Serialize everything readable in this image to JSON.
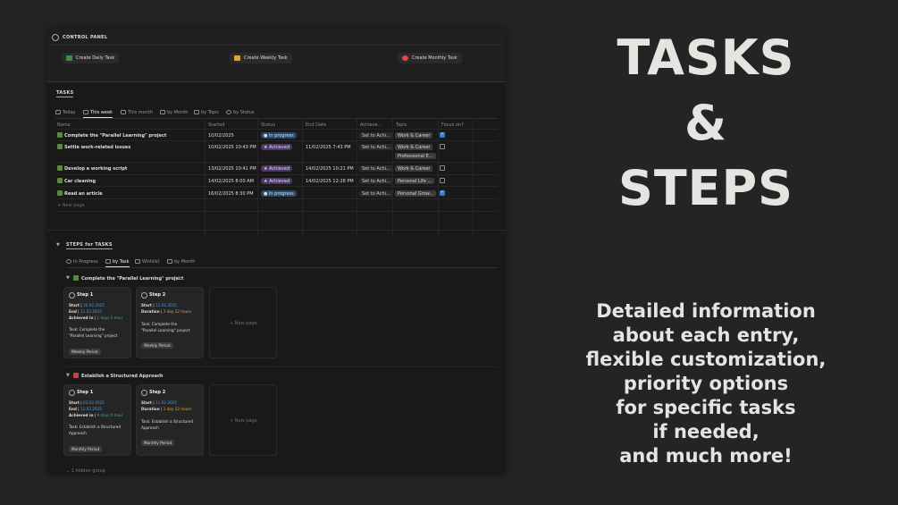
{
  "control_panel": {
    "title": "CONTROL PANEL",
    "buttons": [
      {
        "label": "Create Daily Task",
        "color": "#3f8f4a"
      },
      {
        "label": "Create Weekly Task",
        "color": "#e0a23a"
      },
      {
        "label": "Create Monthly Task",
        "color": "#e04b4b"
      }
    ]
  },
  "tasks": {
    "section_label": "TASKS",
    "tabs": [
      "Today",
      "This week",
      "This month",
      "by Month",
      "by Topic",
      "by Status"
    ],
    "active_tab": "This week",
    "columns": [
      "Name",
      "Started",
      "Status",
      "End Date",
      "Achieve...",
      "Topic",
      "Focus on?"
    ],
    "rows": [
      {
        "name": "Complete the \"Parallel Learning\" project",
        "started": "10/02/2025",
        "status": "In progress",
        "end": "",
        "achieve": "Set to Achi...",
        "topics": [
          "Work & Career"
        ],
        "focus": true
      },
      {
        "name": "Settle work-related issues",
        "started": "10/02/2025 10:43 PM",
        "status": "Achieved",
        "end": "11/02/2025 7:43 PM",
        "achieve": "Set to Achi...",
        "topics": [
          "Work & Career",
          "Professional E..."
        ],
        "focus": false
      },
      {
        "name": "Develop a working script",
        "started": "13/02/2025 10:41 PM",
        "status": "Achieved",
        "end": "14/02/2025 10:21 PM",
        "achieve": "Set to Achi...",
        "topics": [
          "Work & Career"
        ],
        "focus": false
      },
      {
        "name": "Car cleaning",
        "started": "14/02/2025 8:00 AM",
        "status": "Achieved",
        "end": "14/02/2025 12:28 PM",
        "achieve": "Set to Achi...",
        "topics": [
          "Personal Life ..."
        ],
        "focus": false
      },
      {
        "name": "Read an article",
        "started": "16/02/2025 8:30 PM",
        "status": "In progress",
        "end": "",
        "achieve": "Set to Achi...",
        "topics": [
          "Personal Grow..."
        ],
        "focus": true
      }
    ],
    "new_page": "+ New page"
  },
  "steps": {
    "section_label": "STEPS  for  TASKS",
    "tabs": [
      "In Progress",
      "by Task",
      "Wishlist",
      "by Month"
    ],
    "active_tab": "by Task",
    "groups": [
      {
        "title": "Complete the \"Parallel Learning\" project",
        "count": "2",
        "cards": [
          {
            "title": "Step 1",
            "start_label": "Start",
            "start": "10.02.2025",
            "l2_label": "End",
            "l2": "11.02.2025",
            "achieved_label": "Achieved in",
            "achieved": "1 days 0 hour",
            "task_label": "Task:",
            "task_line1": "Complete the",
            "task_line2": "\"Parallel Learning\" project",
            "period": "Weekly Period"
          },
          {
            "title": "Step 2",
            "start_label": "Start",
            "start": "11.02.2025",
            "l2_label": "Duration",
            "l2": "1 day 22 hours",
            "task_label": "Task:",
            "task_line1": "Complete the",
            "task_line2": "\"Parallel Learning\" project",
            "period": "Weekly Period"
          }
        ]
      },
      {
        "title": "Establish a Structured Approach",
        "count": "2",
        "cards": [
          {
            "title": "Step 1",
            "start_label": "Start",
            "start": "03.02.2025",
            "l2_label": "End",
            "l2": "12.02.2025",
            "achieved_label": "Achieved in",
            "achieved": "9 days 0 hour",
            "task_label": "Task:",
            "task_line1": "Establish a Structured",
            "task_line2": "Approach",
            "period": "Monthly Period"
          },
          {
            "title": "Step 2",
            "start_label": "Start",
            "start": "11.02.2025",
            "l2_label": "Duration",
            "l2": "1 day 22 hours",
            "task_label": "Task:",
            "task_line1": "Establish a Structured",
            "task_line2": "Approach",
            "period": "Monthly Period"
          }
        ]
      }
    ],
    "new_page": "+ New page",
    "hidden_group": "1 hidden group"
  },
  "hero": {
    "title_lines": [
      "TASKS",
      "&",
      "STEPS"
    ],
    "subtitle_lines": [
      "Detailed information",
      "about each entry,",
      "flexible customization,",
      "priority options",
      "for specific tasks",
      "if needed,",
      "and much more!"
    ]
  }
}
